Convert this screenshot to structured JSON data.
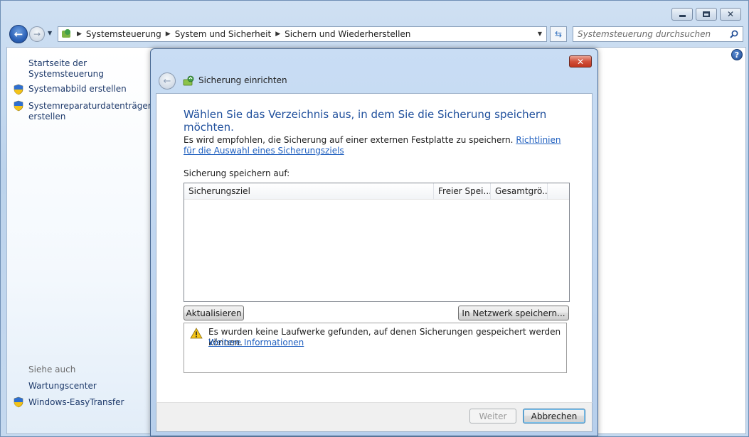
{
  "explorer": {
    "breadcrumb": [
      "Systemsteuerung",
      "System und Sicherheit",
      "Sichern und Wiederherstellen"
    ],
    "search_placeholder": "Systemsteuerung durchsuchen"
  },
  "sidebar": {
    "home_link": "Startseite der Systemsteuerung",
    "tasks": [
      {
        "label": "Systemabbild erstellen",
        "icon": "uac-shield-icon"
      },
      {
        "label_line1": "Systemreparaturdatenträger",
        "label_line2": "erstellen",
        "icon": "uac-shield-icon"
      }
    ],
    "see_also_heading": "Siehe auch",
    "see_also": [
      {
        "label": "Wartungscenter"
      },
      {
        "label": "Windows-EasyTransfer",
        "icon": "uac-shield-icon"
      }
    ]
  },
  "dialog": {
    "title": "Sicherung einrichten",
    "heading": "Wählen Sie das Verzeichnis aus, in dem Sie die Sicherung speichern möchten.",
    "recommendation": "Es wird empfohlen, die Sicherung auf einer externen Festplatte zu speichern.",
    "guidelines_link_line1": "Richtlinien für die Auswahl",
    "guidelines_link_line2": "eines Sicherungsziels",
    "save_to_label": "Sicherung speichern auf:",
    "columns": [
      "Sicherungsziel",
      "Freier Spei...",
      "Gesamtgrö..."
    ],
    "rows": [],
    "refresh_button": "Aktualisieren",
    "network_button": "In Netzwerk speichern...",
    "warning_text": "Es wurden keine Laufwerke gefunden, auf denen Sicherungen gespeichert werden können.",
    "more_info_link": "Weitere Informationen",
    "next_button": "Weiter",
    "cancel_button": "Abbrechen",
    "next_enabled": false
  },
  "colors": {
    "heading_blue": "#1f4f9c",
    "link_blue": "#1f5fbf",
    "close_red": "#c0361f"
  }
}
